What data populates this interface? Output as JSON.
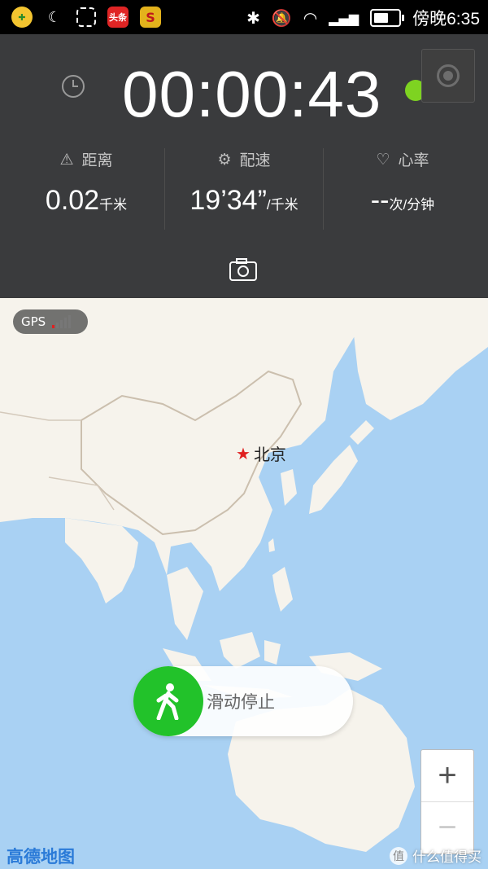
{
  "status_bar": {
    "apps": [
      {
        "name": "app-icon-plus",
        "bg": "#f4c530"
      },
      {
        "name": "app-icon-moon",
        "bg": "#000"
      },
      {
        "name": "app-icon-screenshot",
        "bg": "#000"
      },
      {
        "name": "app-icon-toutiao",
        "label": "头条",
        "bg": "#e02525"
      },
      {
        "name": "app-icon-s",
        "label": "S",
        "bg": "#e3b21c"
      }
    ],
    "time": "傍晚6:35",
    "battery_level": 0.6
  },
  "panel": {
    "timer": "00:00:43",
    "stats": [
      {
        "label": "距离",
        "icon": "road-icon",
        "value": "0.02",
        "unit": "千米"
      },
      {
        "label": "配速",
        "icon": "runner-icon",
        "value": "19’34”",
        "unit": "/千米"
      },
      {
        "label": "心率",
        "icon": "heart-icon",
        "value": "--",
        "unit": "次/分钟"
      }
    ],
    "gps_status_color": "#7ed321"
  },
  "map": {
    "gps_label": "GPS",
    "city_label": "北京",
    "slider_label": "滑动停止",
    "zoom_in": "+",
    "zoom_out": "−",
    "provider_logo": "高德地图",
    "watermark": "什么值得买"
  },
  "colors": {
    "accent_green": "#22c22a",
    "panel_bg": "#353535",
    "sea": "#a9d1f3",
    "land": "#f6f3ec"
  }
}
